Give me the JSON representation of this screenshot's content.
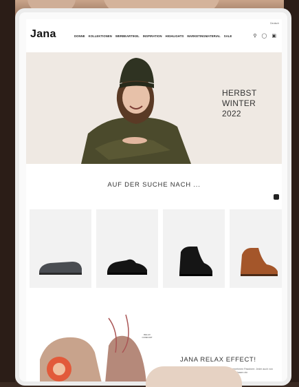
{
  "header": {
    "logo": "Jana",
    "nav": [
      "DONNE",
      "KOLLEKTIONEN",
      "WERBEARTIKEL",
      "INSPIRATION",
      "HIGHLIGHTS",
      "MARKETINGMATERIAL",
      "SALE"
    ],
    "top_link": "Deutsch"
  },
  "hero": {
    "headline_line1": "HERBST",
    "headline_line2": "WINTER",
    "headline_line3": "2022"
  },
  "search_section": {
    "title": "AUF DER SUCHE NACH ..."
  },
  "relax": {
    "title": "JANA RELAX EFFECT!",
    "badge": "RELAX COMFORT",
    "copy": "Von der Sohle über das Fußbett bis hin zum angenehmen Passform: Jeder auch von Jana alles, was dem Fuß in sämtlichen Belastungsphasen ein"
  }
}
